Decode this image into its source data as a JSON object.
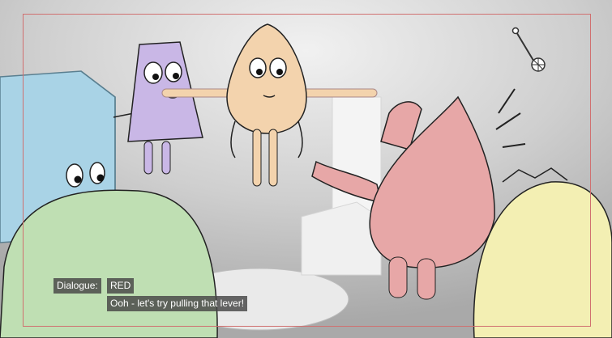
{
  "dialogue": {
    "label": "Dialogue:",
    "speaker": "RED",
    "line": "Ooh - let's try pulling that lever!"
  },
  "colors": {
    "background": "#c9c9c9",
    "frame_guide": "#d07070",
    "blue_block": "#a9d3e6",
    "purple_character": "#c9b7e6",
    "orange_character": "#f3d3ad",
    "red_character": "#e7a7a7",
    "green_blob": "#bfdfb3",
    "yellow_blob": "#f3efb3",
    "white_box": "#f4f4f4"
  },
  "icons": [
    "lever-icon"
  ]
}
